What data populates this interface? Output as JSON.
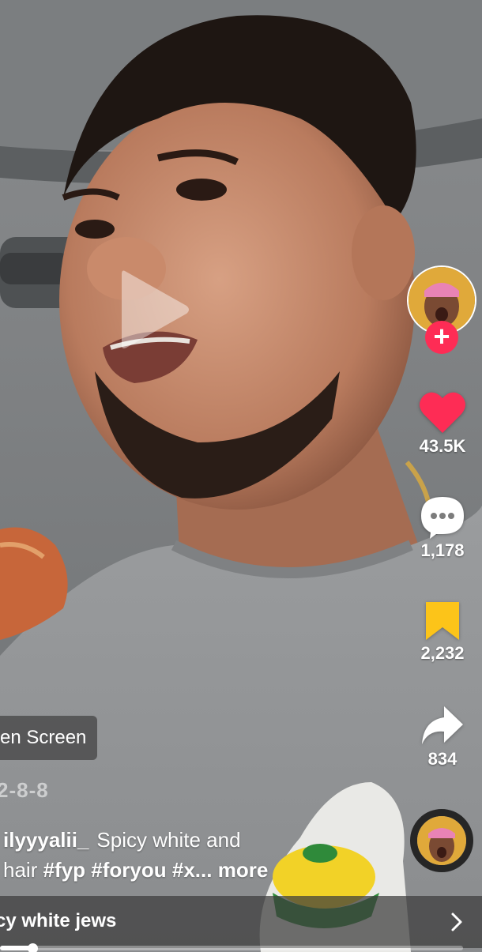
{
  "video": {
    "date_text": "2-8-8",
    "green_screen_label": "en Screen",
    "progress": 0.07
  },
  "caption": {
    "username": "ilyyyalii_",
    "line1": "Spicy white and",
    "line2_prefix": "hair",
    "hashtags": [
      "#fyp",
      "#foryou",
      "#x..."
    ],
    "more_label": "more"
  },
  "actions": {
    "like_count": "43.5K",
    "comment_count": "1,178",
    "bookmark_count": "2,232",
    "share_count": "834"
  },
  "sound": {
    "title": "cy white jews"
  },
  "colors": {
    "like": "#fe2c55",
    "bookmark": "#fcc419",
    "follow": "#fe2c55"
  },
  "icons": {
    "play": "play-icon",
    "follow": "plus-icon",
    "like": "heart-icon",
    "comment": "comment-bubble-icon",
    "bookmark": "bookmark-icon",
    "share": "share-arrow-icon",
    "sound": "chevron-right-icon"
  }
}
